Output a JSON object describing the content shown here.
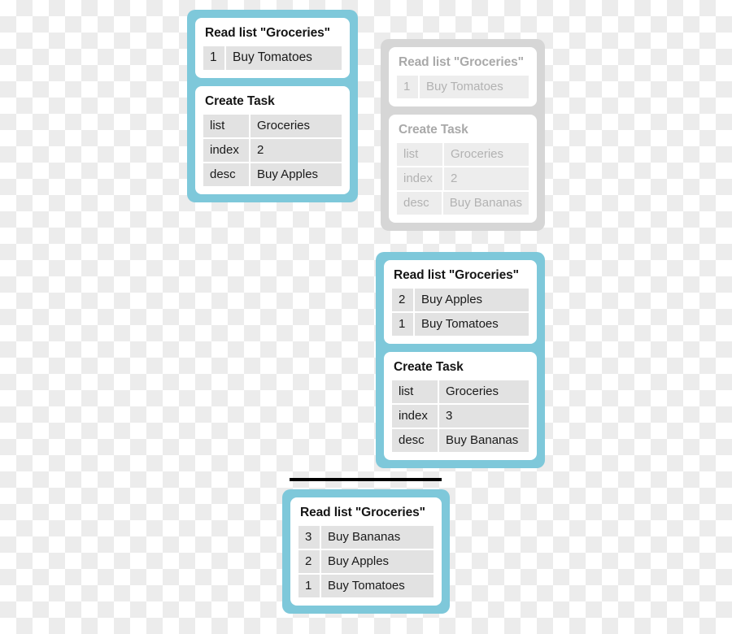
{
  "diagram": {
    "title": "Read list / Create Task operation sequence",
    "colors": {
      "accent_teal": "#7ec8da",
      "ghost_gray": "#d6d6d6",
      "cell_gray": "#e2e2e2",
      "ghost_cell": "#ededed",
      "text": "#1a1a1a",
      "ghost_text": "#b2b2b2",
      "rule": "#000000"
    }
  },
  "steps": [
    {
      "id": "step1",
      "style": "teal",
      "read_card": {
        "title": "Read list \"Groceries\"",
        "rows": [
          {
            "index": "1",
            "desc": "Buy Tomatoes"
          }
        ]
      },
      "create_card": {
        "title": "Create Task",
        "fields": [
          {
            "key": "list",
            "value": "Groceries"
          },
          {
            "key": "index",
            "value": "2"
          },
          {
            "key": "desc",
            "value": "Buy Apples"
          }
        ]
      }
    },
    {
      "id": "ghost",
      "style": "ghost",
      "read_card": {
        "title": "Read list \"Groceries\"",
        "rows": [
          {
            "index": "1",
            "desc": "Buy Tomatoes"
          }
        ]
      },
      "create_card": {
        "title": "Create Task",
        "fields": [
          {
            "key": "list",
            "value": "Groceries"
          },
          {
            "key": "index",
            "value": "2"
          },
          {
            "key": "desc",
            "value": "Buy Bananas"
          }
        ]
      }
    },
    {
      "id": "step2",
      "style": "teal",
      "read_card": {
        "title": "Read list \"Groceries\"",
        "rows": [
          {
            "index": "2",
            "desc": "Buy Apples"
          },
          {
            "index": "1",
            "desc": "Buy Tomatoes"
          }
        ]
      },
      "create_card": {
        "title": "Create Task",
        "fields": [
          {
            "key": "list",
            "value": "Groceries"
          },
          {
            "key": "index",
            "value": "3"
          },
          {
            "key": "desc",
            "value": "Buy Bananas"
          }
        ]
      }
    },
    {
      "id": "step3",
      "style": "teal",
      "read_card": {
        "title": "Read list \"Groceries\"",
        "rows": [
          {
            "index": "3",
            "desc": "Buy Bananas"
          },
          {
            "index": "2",
            "desc": "Buy Apples"
          },
          {
            "index": "1",
            "desc": "Buy Tomatoes"
          }
        ]
      }
    }
  ]
}
